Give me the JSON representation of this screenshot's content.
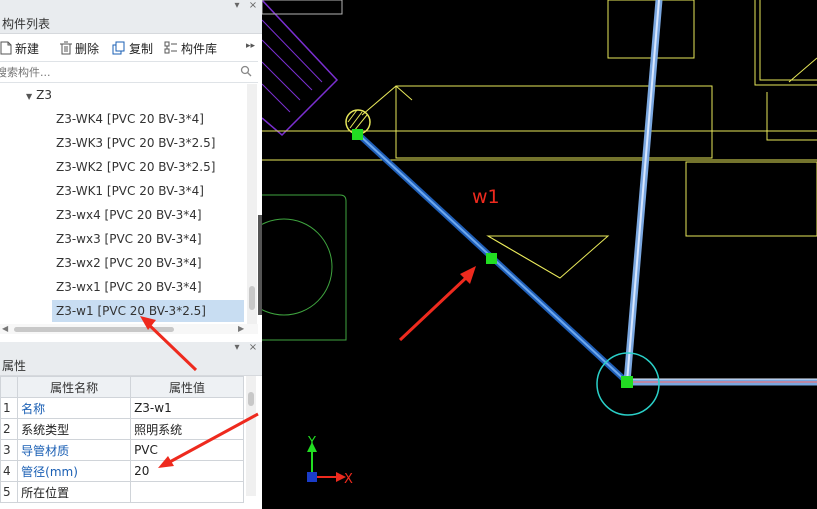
{
  "component_panel": {
    "title": "构件列表",
    "toolbar": {
      "new": "新建",
      "delete": "删除",
      "copy": "复制",
      "library": "构件库",
      "more": "▸▸"
    },
    "search_placeholder": "搜索构件...",
    "group": "Z3",
    "items": [
      "Z3-WK4 [PVC 20 BV-3*4]",
      "Z3-WK3 [PVC 20 BV-3*2.5]",
      "Z3-WK2 [PVC 20 BV-3*2.5]",
      "Z3-WK1 [PVC 20 BV-3*4]",
      "Z3-wx4 [PVC 20 BV-3*4]",
      "Z3-wx3 [PVC 20 BV-3*4]",
      "Z3-wx2 [PVC 20 BV-3*4]",
      "Z3-wx1 [PVC 20 BV-3*4]",
      "Z3-w1 [PVC 20 BV-3*2.5]"
    ],
    "selected": "Z3-w1 [PVC 20 BV-3*2.5]"
  },
  "property_panel": {
    "title": "属性",
    "headers": {
      "name": "属性名称",
      "value": "属性值"
    },
    "rows": [
      {
        "index": "1",
        "name": "名称",
        "value": "Z3-w1"
      },
      {
        "index": "2",
        "name": "系统类型",
        "value": "照明系统"
      },
      {
        "index": "3",
        "name": "导管材质",
        "value": "PVC"
      },
      {
        "index": "4",
        "name": "管径(mm)",
        "value": "20"
      },
      {
        "index": "5",
        "name": "所在位置",
        "value": ""
      }
    ]
  },
  "canvas": {
    "pipe_label": "w1",
    "axis_y": "Y",
    "axis_x": "X"
  },
  "colors": {
    "annotation_red": "#ee2a1e",
    "pipe_blue": "#2f78d6",
    "grip_green": "#22dd22",
    "cad_yellow": "#e8e85a",
    "selected_row": "#c8ddf2",
    "link_blue": "#1a5fb4"
  }
}
